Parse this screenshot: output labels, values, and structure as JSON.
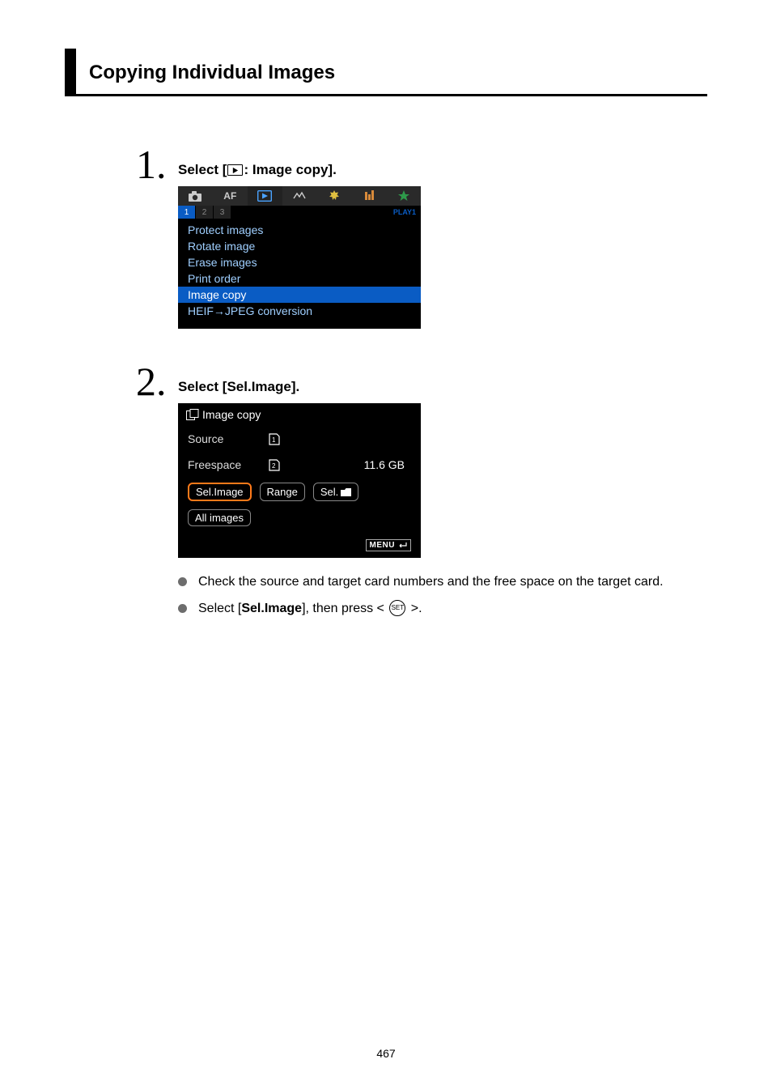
{
  "page": {
    "number": "467"
  },
  "title": "Copying Individual Images",
  "step1": {
    "prefix": "Select [",
    "suffix": ": Image copy].",
    "tabs": {
      "af": "AF",
      "play_label": "PLAY1"
    },
    "subtabs": [
      "1",
      "2",
      "3"
    ],
    "items": {
      "protect": "Protect images",
      "rotate": "Rotate image",
      "erase": "Erase images",
      "print": "Print order",
      "copy": "Image copy",
      "heif": "HEIF→JPEG conversion"
    }
  },
  "step2": {
    "title": "Select [Sel.Image].",
    "header": "Image copy",
    "source": {
      "label": "Source"
    },
    "freespace": {
      "label": "Freespace",
      "value": "11.6 GB"
    },
    "buttons": {
      "sel_image": "Sel.Image",
      "range": "Range",
      "sel_folder": "Sel.",
      "all": "All images"
    },
    "menu_return": "MENU",
    "bullet1": "Check the source and target card numbers and the free space on the target card.",
    "bullet2_a": "Select [",
    "bullet2_b": "Sel.Image",
    "bullet2_c": "], then press < ",
    "bullet2_d": " >.",
    "set_label": "SET"
  }
}
